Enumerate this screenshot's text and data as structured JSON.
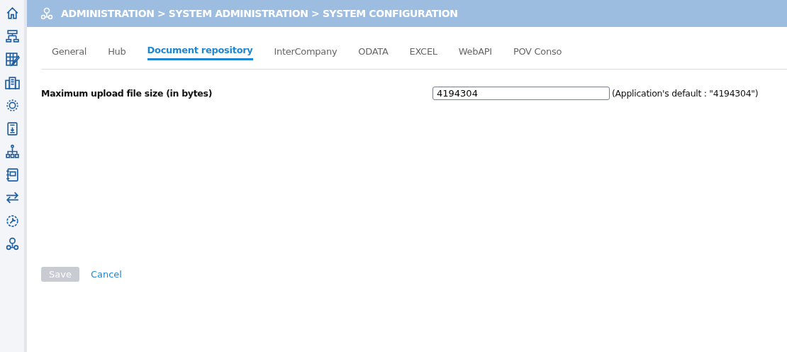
{
  "header": {
    "breadcrumb": "ADMINISTRATION > SYSTEM ADMINISTRATION > SYSTEM CONFIGURATION"
  },
  "tabs": [
    {
      "label": "General",
      "selected": false
    },
    {
      "label": "Hub",
      "selected": false
    },
    {
      "label": "Document repository",
      "selected": true
    },
    {
      "label": "InterCompany",
      "selected": false
    },
    {
      "label": "ODATA",
      "selected": false
    },
    {
      "label": "EXCEL",
      "selected": false
    },
    {
      "label": "WebAPI",
      "selected": false
    },
    {
      "label": "POV Conso",
      "selected": false
    }
  ],
  "setting": {
    "label": "Maximum upload file size (in bytes)",
    "value": "4194304",
    "hint": "(Application's default : \"4194304\")"
  },
  "buttons": {
    "save": {
      "label": "Save",
      "disabled": true
    },
    "cancel": {
      "label": "Cancel"
    }
  }
}
